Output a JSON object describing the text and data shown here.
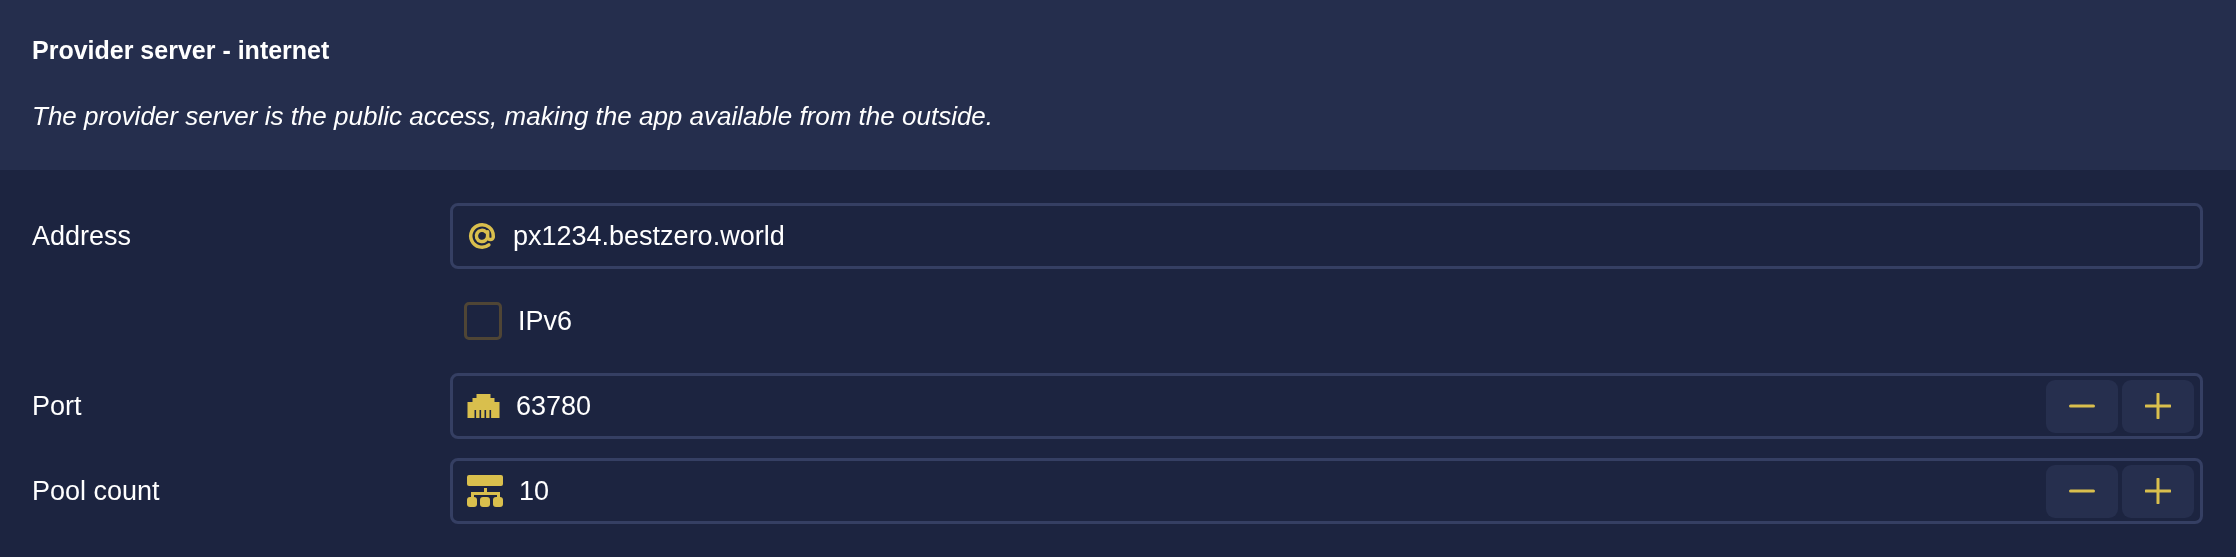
{
  "header": {
    "title": "Provider server - internet",
    "description": "The provider server is the public access, making the app available from the outside."
  },
  "fields": [
    {
      "kind": "address",
      "label": "Address",
      "value": "px1234.bestzero.world"
    },
    {
      "kind": "toggle",
      "label": "IPv6",
      "checked": false
    },
    {
      "kind": "port",
      "label": "Port",
      "value": "63780"
    },
    {
      "kind": "count",
      "label": "Pool count",
      "value": "10"
    }
  ]
}
